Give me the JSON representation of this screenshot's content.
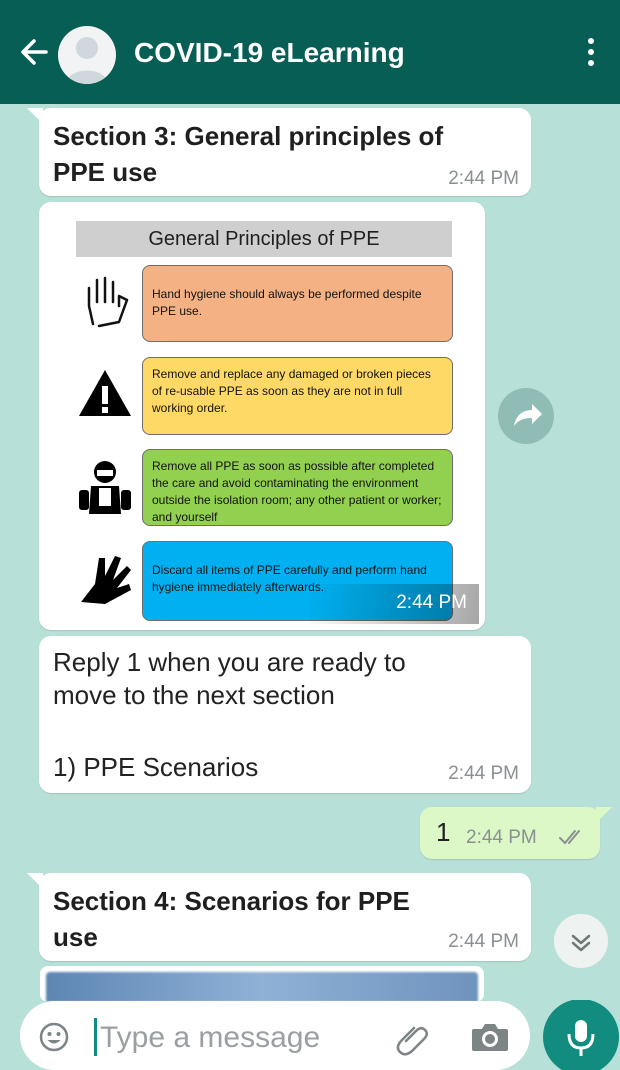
{
  "header": {
    "back_icon": "arrow-left-icon",
    "title": "COVID-19 eLearning",
    "menu_icon": "more-vert-icon",
    "bg_color": "#075e54"
  },
  "messages": {
    "section3": {
      "title_line1": "Section 3: General principles of",
      "title_line2": "PPE use",
      "time": "2:44 PM"
    },
    "image": {
      "title": "General Principles of PPE",
      "rows": [
        {
          "icon": "hand-icon",
          "text": "Hand hygiene should always be performed despite PPE use."
        },
        {
          "icon": "warning-triangle-icon",
          "text": "Remove and replace any damaged or broken pieces of re-usable PPE as soon as they are not in full working order."
        },
        {
          "icon": "worker-ppe-icon",
          "text": "Remove all PPE as soon as possible after completed the care and avoid contaminating the environment outside the isolation room; any other patient or worker; and yourself"
        },
        {
          "icon": "glove-icon",
          "text": "Discard all items of PPE carefully and perform hand hygiene immediately afterwards."
        }
      ],
      "time": "2:44 PM"
    },
    "reply_prompt": {
      "line1": "Reply 1 when you are ready to",
      "line2": "move to the next section",
      "option": "1) PPE Scenarios",
      "time": "2:44 PM"
    },
    "outgoing": {
      "text": "1",
      "time": "2:44 PM",
      "status_icon": "double-check-icon"
    },
    "section4": {
      "title_line1": "Section 4: Scenarios for PPE",
      "title_line2": "use",
      "time": "2:44 PM"
    }
  },
  "composer": {
    "placeholder": "Type a message",
    "emoji_icon": "emoji-icon",
    "attach_icon": "paperclip-icon",
    "camera_icon": "camera-icon",
    "mic_icon": "mic-icon",
    "accent": "#128c7e"
  }
}
